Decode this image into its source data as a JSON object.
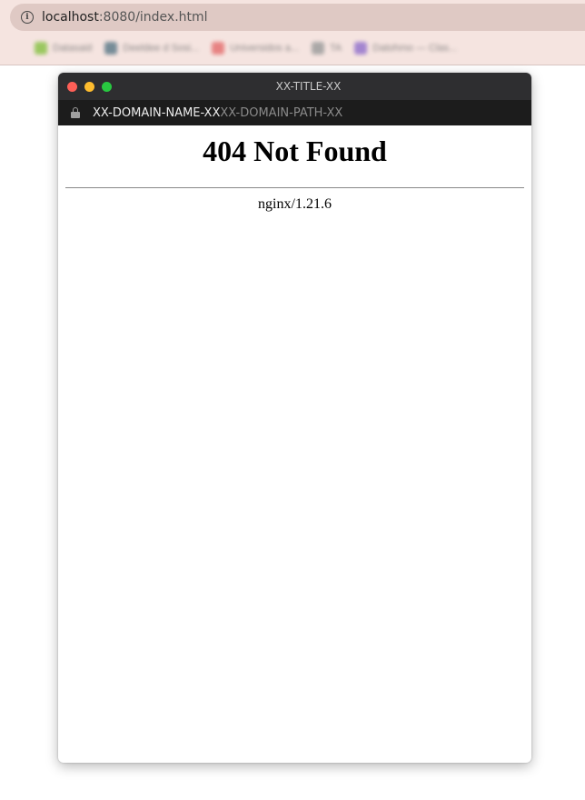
{
  "browser": {
    "url_host": "localhost",
    "url_rest": ":8080/index.html",
    "bookmarks": [
      {
        "label": "Datasaid",
        "color": "#8bc34a"
      },
      {
        "label": "Deeldee d Sosi...",
        "color": "#607d8b"
      },
      {
        "label": "Universidos a...",
        "color": "#e57373"
      },
      {
        "label": "TA",
        "color": "#9e9e9e"
      },
      {
        "label": "Datohmo — Clas...",
        "color": "#9575cd"
      }
    ]
  },
  "window": {
    "title": "XX-TITLE-XX",
    "domain_name": "XX-DOMAIN-NAME-XX",
    "domain_path": "XX-DOMAIN-PATH-XX"
  },
  "page": {
    "heading": "404 Not Found",
    "server": "nginx/1.21.6"
  }
}
